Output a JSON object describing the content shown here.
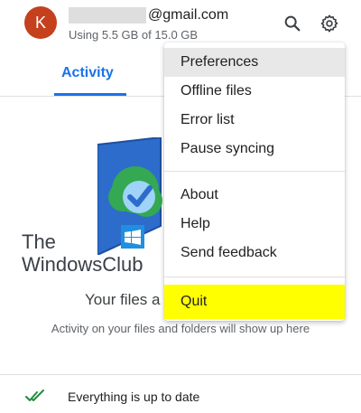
{
  "account": {
    "avatar_letter": "K",
    "email_domain": "@gmail.com",
    "storage": "Using 5.5 GB of 15.0 GB"
  },
  "tabs": {
    "activity": "Activity"
  },
  "menu": {
    "items": [
      {
        "label": "Preferences"
      },
      {
        "label": "Offline files"
      },
      {
        "label": "Error list"
      },
      {
        "label": "Pause syncing"
      },
      {
        "label": "About"
      },
      {
        "label": "Help"
      },
      {
        "label": "Send feedback"
      },
      {
        "label": "Quit"
      }
    ],
    "selected_item": "Preferences",
    "highlighted_item": "Quit"
  },
  "watermark": {
    "line1": "The",
    "line2": "WindowsClub"
  },
  "empty_state": {
    "title": "Your files a",
    "subtitle": "Activity on your files and folders will show up here"
  },
  "status": {
    "text": "Everything is up to date"
  },
  "icons": {
    "search": "search-icon",
    "settings": "gear-icon",
    "sync_done": "double-check-icon"
  },
  "colors": {
    "accent": "#1a73e8",
    "avatar": "#c5401c",
    "highlight": "#ffff00",
    "check": "#1e8e3e"
  }
}
